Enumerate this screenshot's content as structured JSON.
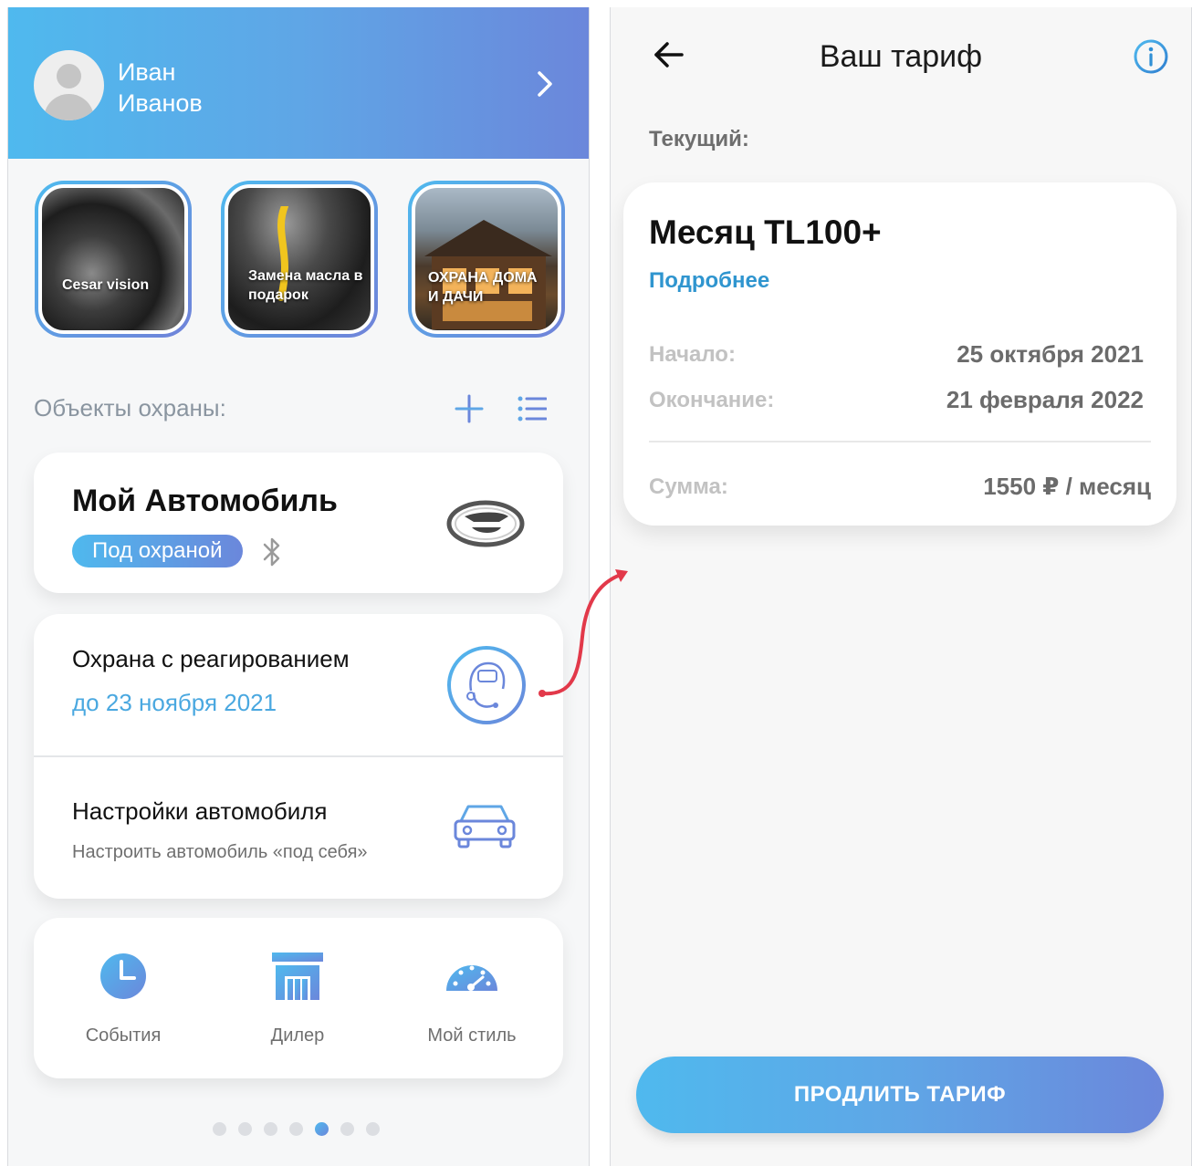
{
  "profile": {
    "first_name": "Иван",
    "last_name": "Иванов"
  },
  "stories": [
    {
      "label": "Cesar vision"
    },
    {
      "label": "Замена масла в подарок"
    },
    {
      "label": "ОХРАНА ДОМА И ДАЧИ"
    }
  ],
  "objects": {
    "title": "Объекты охраны:"
  },
  "vehicle": {
    "name": "Мой Автомобиль",
    "status": "Под охраной"
  },
  "services": [
    {
      "title": "Охрана с реагированием",
      "subtitle": "до 23 ноября 2021",
      "icon": "operator-headset-icon"
    },
    {
      "title": "Настройки автомобиля",
      "subtitle": "Настроить автомобиль «под себя»",
      "icon": "car-front-icon"
    }
  ],
  "quick_actions": [
    {
      "label": "События",
      "icon": "clock-icon"
    },
    {
      "label": "Дилер",
      "icon": "store-icon"
    },
    {
      "label": "Мой стиль",
      "icon": "speedometer-icon"
    }
  ],
  "pager": {
    "count": 7,
    "active": 5
  },
  "tariff_screen": {
    "title": "Ваш тариф",
    "current_label": "Текущий:",
    "tariff": {
      "name": "Месяц TL100+",
      "more_link": "Подробнее",
      "start_label": "Начало:",
      "start_value": "25 октября 2021",
      "end_label": "Окончание:",
      "end_value": "21 февраля 2022",
      "sum_label": "Сумма:",
      "sum_value": "1550 ₽ / месяц"
    },
    "extend_button": "ПРОДЛИТЬ ТАРИФ"
  },
  "colors": {
    "gradient_start": "#4fb9ee",
    "gradient_end": "#6b87db",
    "accent_blue": "#4aa8e0",
    "arrow_red": "#e2394a"
  }
}
